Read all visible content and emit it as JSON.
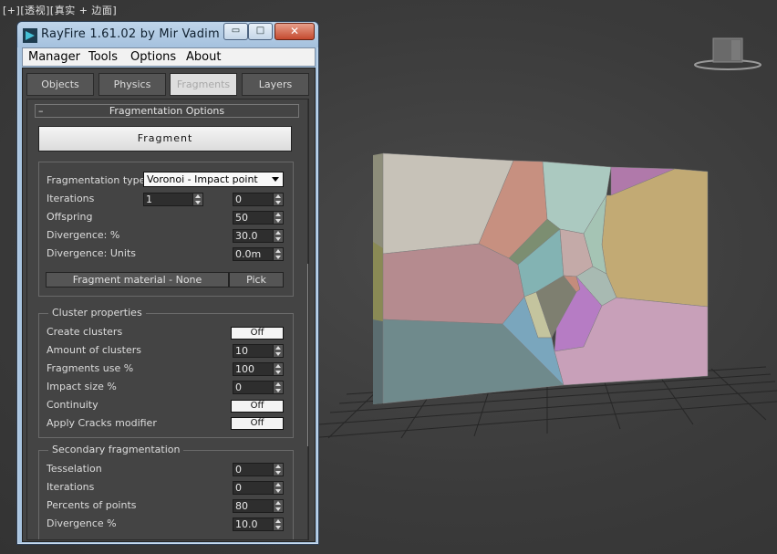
{
  "viewport": {
    "label_parts": [
      "[+]",
      "[透视]",
      "[真实 + 边面]"
    ]
  },
  "window": {
    "title": "RayFire 1.61.02  by Mir Vadim",
    "min_glyph": "▭",
    "max_glyph": "□",
    "close_glyph": "✕"
  },
  "menu": {
    "items": [
      "Manager",
      "Tools",
      "Options",
      "About"
    ]
  },
  "tabs": [
    "Objects",
    "Physics",
    "Fragments",
    "Layers"
  ],
  "rollout": {
    "minus": "–",
    "title": "Fragmentation Options",
    "fragment_button": "Fragment"
  },
  "frag": {
    "type_label": "Fragmentation type",
    "type_value": "Voronoi - Impact point",
    "iterations_label": "Iterations",
    "iterations_a": "1",
    "iterations_b": "0",
    "offspring_label": "Offspring",
    "offspring_value": "50",
    "div_pct_label": "Divergence: %",
    "div_pct_value": "30.0",
    "div_units_label": "Divergence: Units",
    "div_units_value": "0.0m",
    "material_label": "Fragment material - None",
    "pick_label": "Pick"
  },
  "cluster": {
    "legend": "Cluster properties",
    "create_label": "Create clusters",
    "create_value": "Off",
    "amount_label": "Amount of clusters",
    "amount_value": "10",
    "use_label": "Fragments use %",
    "use_value": "100",
    "impact_label": "Impact size %",
    "impact_value": "0",
    "continuity_label": "Continuity",
    "continuity_value": "Off",
    "cracks_label": "Apply Cracks modifier",
    "cracks_value": "Off"
  },
  "secondary": {
    "legend": "Secondary fragmentation",
    "tess_label": "Tesselation",
    "tess_value": "0",
    "iter_label": "Iterations",
    "iter_value": "0",
    "points_label": "Percents of points",
    "points_value": "80",
    "div_label": "Divergence %",
    "div_value": "10.0"
  },
  "colors": {
    "panel_bg": "#444444",
    "titlebar": "#a5c1de",
    "close_button": "#c54a2f",
    "viewport_bg": "#3d3d3d"
  }
}
